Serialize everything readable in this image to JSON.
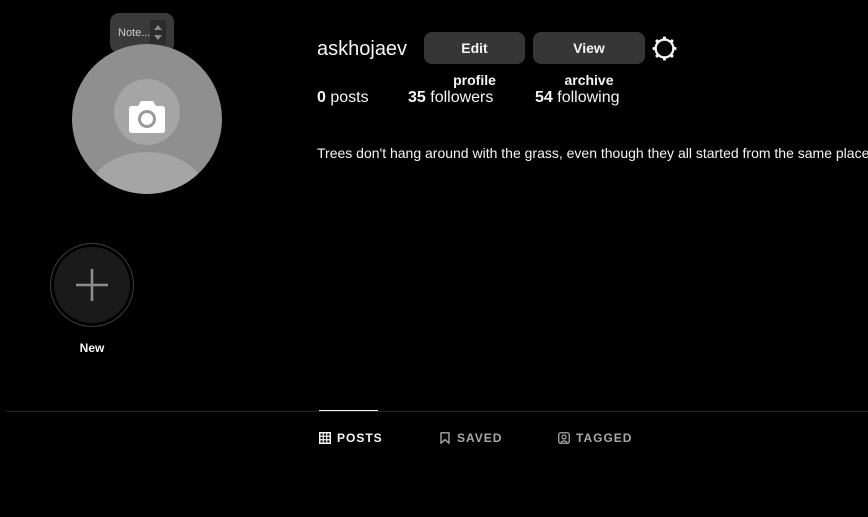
{
  "note": {
    "placeholder": "Note..."
  },
  "profile": {
    "username": "askhojaev",
    "edit_profile_label": "Edit profile",
    "view_archive_label": "View archive",
    "bio": "Trees don't hang around with the grass, even though they all started from the same place"
  },
  "stats": {
    "posts_count": "0",
    "posts_label": "posts",
    "followers_count": "35",
    "followers_label": "followers",
    "following_count": "54",
    "following_label": "following"
  },
  "highlights": {
    "new_label": "New"
  },
  "tabs": [
    {
      "label": "POSTS",
      "icon": "grid-icon",
      "active": true
    },
    {
      "label": "SAVED",
      "icon": "bookmark-icon",
      "active": false
    },
    {
      "label": "TAGGED",
      "icon": "tag-user-icon",
      "active": false
    }
  ],
  "colors": {
    "background": "#000000",
    "button_bg": "#363636",
    "text_primary": "#f5f5f5",
    "text_secondary": "#a8a8a8",
    "avatar_bg": "#8f8f8f"
  }
}
